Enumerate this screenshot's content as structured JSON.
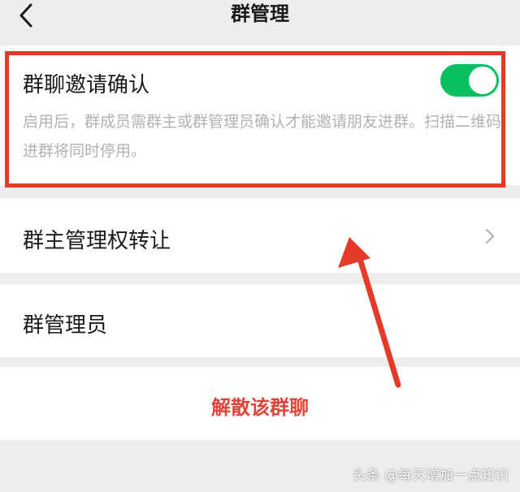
{
  "nav": {
    "back_icon": "chevron-left-icon",
    "title": "群管理"
  },
  "invite_confirm": {
    "label": "群聊邀请确认",
    "enabled": true,
    "description": "启用后，群成员需群主或群管理员确认才能邀请朋友进群。扫描二维码进群将同时停用。"
  },
  "transfer": {
    "label": "群主管理权转让",
    "chevron_icon": "chevron-right-icon"
  },
  "admins": {
    "label": "群管理员"
  },
  "disband": {
    "label": "解散该群聊"
  },
  "watermark": {
    "text": "头条 @每天增加一点知识"
  },
  "colors": {
    "toggle_on": "#07c160",
    "highlight": "#e53a28",
    "danger_text": "#e0443a",
    "background": "#ededed"
  }
}
